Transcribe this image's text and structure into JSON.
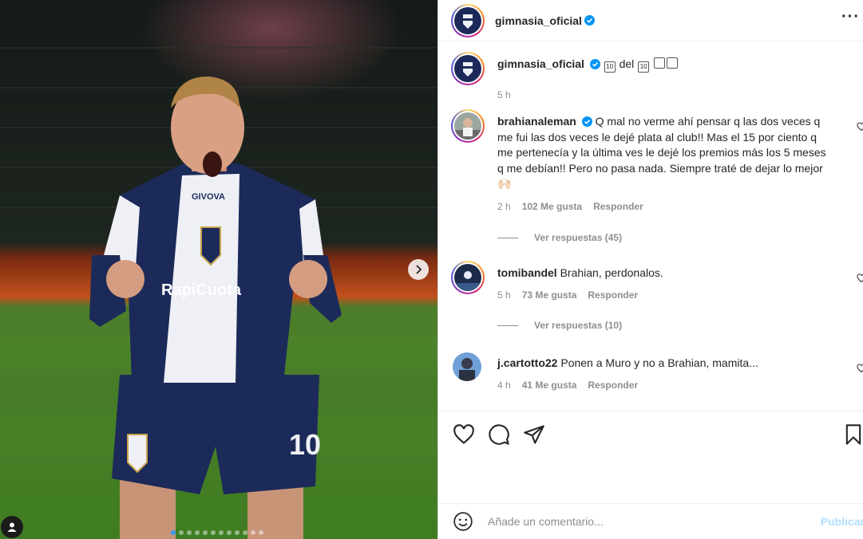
{
  "post": {
    "author": "gimnasia_oficial",
    "more_icon": "more-horizontal-icon",
    "carousel": {
      "slide_count": 12,
      "active_index": 0
    }
  },
  "photo": {
    "jersey_sponsor": "RapiCuota",
    "jersey_number": "10",
    "jersey_brand": "GIVOVA"
  },
  "caption": {
    "username": "gimnasia_oficial",
    "text_parts": [
      "10",
      " del ",
      "10"
    ],
    "time": "5 h"
  },
  "comments": [
    {
      "username": "brahianaleman",
      "verified": true,
      "text": "Q mal no verme ahí pensar q las dos veces q me fui las dos veces le dejé plata al club!! Mas el 15 por ciento q me pertenecía y la última ves le dejé los premios más los 5 meses q me debían!! Pero no pasa nada. Siempre traté de dejar lo mejor 🙌🏻",
      "time": "2 h",
      "likes": "102 Me gusta",
      "reply": "Responder",
      "view_replies": "Ver respuestas (45)"
    },
    {
      "username": "tomibandel",
      "verified": false,
      "text": "Brahian, perdonalos.",
      "time": "5 h",
      "likes": "73 Me gusta",
      "reply": "Responder",
      "view_replies": "Ver respuestas (10)"
    },
    {
      "username": "j.cartotto22",
      "verified": false,
      "text": "Ponen a Muro y no a Brahian, mamita...",
      "time": "4 h",
      "likes": "41 Me gusta",
      "reply": "Responder"
    }
  ],
  "actions": {
    "like_icon": "heart-icon",
    "comment_icon": "comment-icon",
    "share_icon": "share-icon",
    "save_icon": "bookmark-icon"
  },
  "composer": {
    "placeholder": "Añade un comentario...",
    "post_label": "Publicar"
  },
  "colors": {
    "accent": "#3897f0",
    "verified": "#0095f6",
    "post_disabled": "#b2dffc",
    "team_navy": "#1c2a5a"
  }
}
